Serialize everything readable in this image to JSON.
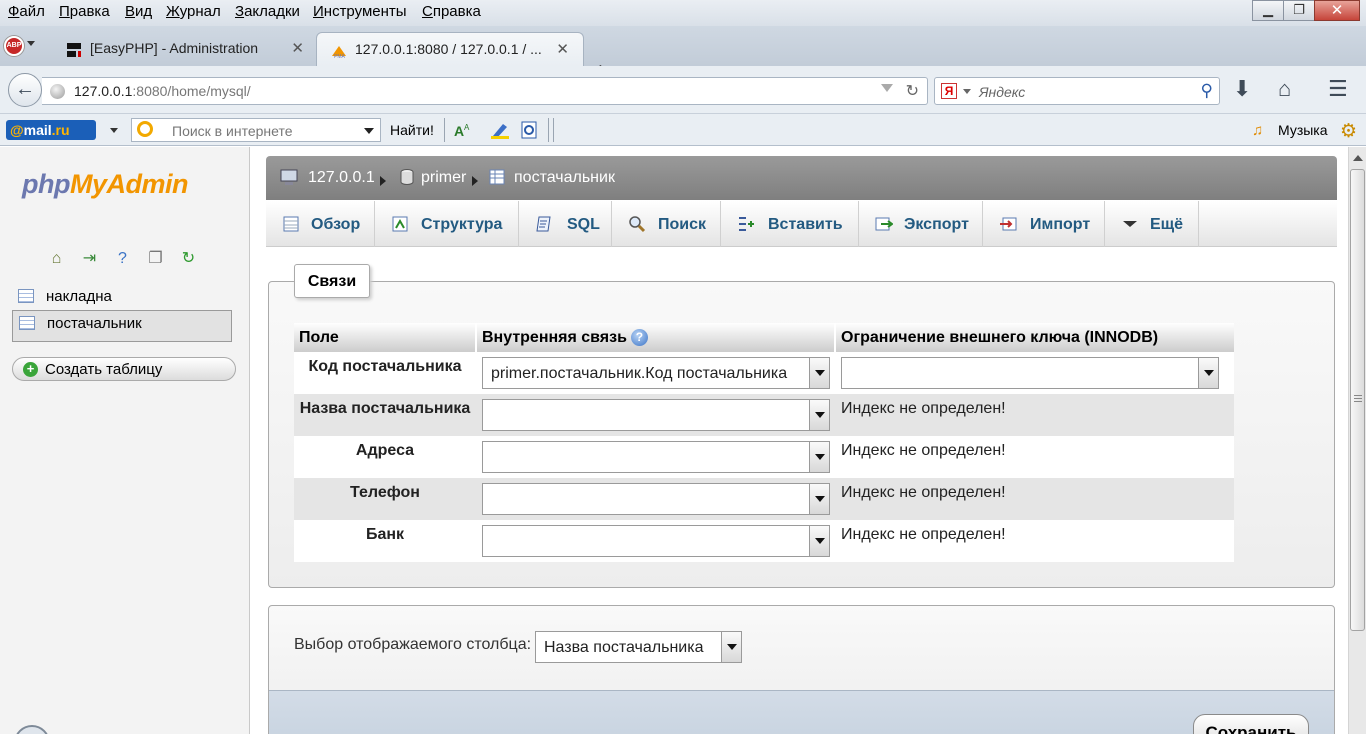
{
  "menu": {
    "items": [
      "Файл",
      "Правка",
      "Вид",
      "Журнал",
      "Закладки",
      "Инструменты",
      "Справка"
    ]
  },
  "tabs": {
    "inactive_title": "[EasyPHP] - Administration",
    "active_title": "127.0.0.1:8080 / 127.0.0.1 / ..."
  },
  "nav": {
    "url_host": "127.0.0.1",
    "url_rest": ":8080/home/mysql/",
    "search_placeholder": "Яндекс",
    "search_engine_icon": "yandex-icon"
  },
  "mailbar": {
    "logo_at": "@",
    "logo_mail": "mail",
    "logo_ru": ".ru",
    "search_placeholder": "Поиск в интернете",
    "find_label": "Найти!",
    "music_label": "Музыка"
  },
  "sidebar": {
    "logo_php": "php",
    "logo_myadmin": "MyAdmin",
    "tables": [
      {
        "label": "накладна",
        "selected": false
      },
      {
        "label": "постачальник",
        "selected": true
      }
    ],
    "create_table_label": "Создать таблицу"
  },
  "breadcrumb": {
    "server": "127.0.0.1",
    "database": "primer",
    "table": "постачальник"
  },
  "main_tabs": [
    {
      "label": "Обзор",
      "icon": "browse-icon"
    },
    {
      "label": "Структура",
      "icon": "structure-icon"
    },
    {
      "label": "SQL",
      "icon": "sql-icon"
    },
    {
      "label": "Поиск",
      "icon": "search-icon"
    },
    {
      "label": "Вставить",
      "icon": "insert-icon"
    },
    {
      "label": "Экспорт",
      "icon": "export-icon"
    },
    {
      "label": "Импорт",
      "icon": "import-icon"
    },
    {
      "label": "Ещё",
      "icon": "more-icon"
    }
  ],
  "relations": {
    "legend": "Связи",
    "headers": {
      "field": "Поле",
      "internal": "Внутренняя связь",
      "foreign": "Ограничение внешнего ключа (INNODB)"
    },
    "rows": [
      {
        "field": "Код постачальника",
        "internal": "primer.постачальник.Код постачальника",
        "foreign": "",
        "foreign_is_select": true
      },
      {
        "field": "Назва постачальника",
        "internal": "",
        "foreign": "Индекс не определен!",
        "foreign_is_select": false
      },
      {
        "field": "Адреса",
        "internal": "",
        "foreign": "Индекс не определен!",
        "foreign_is_select": false
      },
      {
        "field": "Телефон",
        "internal": "",
        "foreign": "Индекс не определен!",
        "foreign_is_select": false
      },
      {
        "field": "Банк",
        "internal": "",
        "foreign": "Индекс не определен!",
        "foreign_is_select": false
      }
    ]
  },
  "display": {
    "label": "Выбор отображаемого столбца:",
    "value": "Назва постачальника",
    "save_label": "Сохранить"
  },
  "colors": {
    "link_blue": "#235a81",
    "logo_php": "#6c78af",
    "logo_myadmin": "#f29500",
    "breadcrumb_bg": "#8c8c8c"
  }
}
